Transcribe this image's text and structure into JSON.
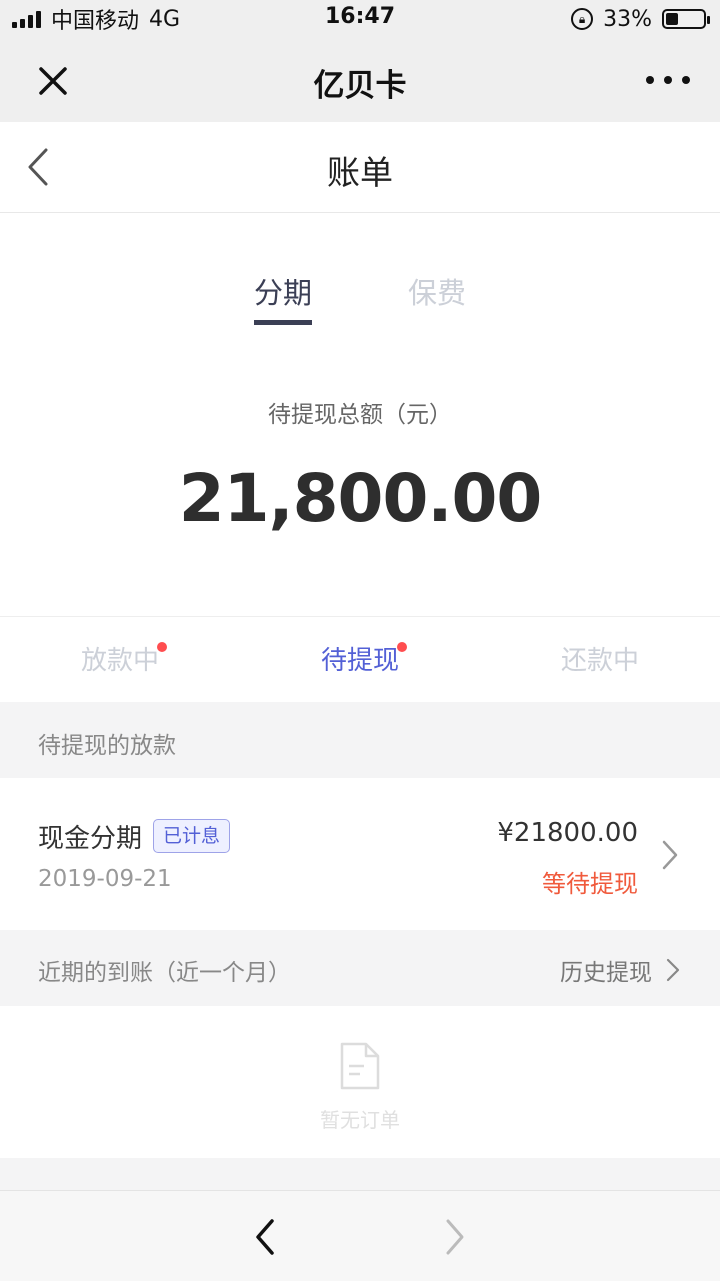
{
  "status_bar": {
    "carrier": "中国移动",
    "network": "4G",
    "time": "16:47",
    "battery_percent": "33%",
    "battery_level": 0.33
  },
  "webview": {
    "title": "亿贝卡",
    "close_icon": "close-icon",
    "more_icon": "more-icon"
  },
  "navbar": {
    "title": "账单",
    "back_icon": "back-chevron-icon"
  },
  "main_tabs": [
    {
      "label": "分期",
      "active": true
    },
    {
      "label": "保费",
      "active": false
    }
  ],
  "summary": {
    "label": "待提现总额（元）",
    "amount": "21,800.00"
  },
  "status_tabs": [
    {
      "label": "放款中",
      "active": false,
      "has_dot": true
    },
    {
      "label": "待提现",
      "active": true,
      "has_dot": true
    },
    {
      "label": "还款中",
      "active": false,
      "has_dot": false
    }
  ],
  "pending_section": {
    "title": "待提现的放款"
  },
  "loan_item": {
    "name": "现金分期",
    "badge": "已计息",
    "date": "2019-09-21",
    "amount": "¥21800.00",
    "status": "等待提现"
  },
  "recent_section": {
    "title": "近期的到账（近一个月）",
    "history_link": "历史提现"
  },
  "empty_state": {
    "icon": "empty-document-icon",
    "text": "暂无订单"
  },
  "colors": {
    "accent": "#5360d6",
    "status_red": "#f05a3c",
    "dot_red": "#ff4d4f"
  }
}
